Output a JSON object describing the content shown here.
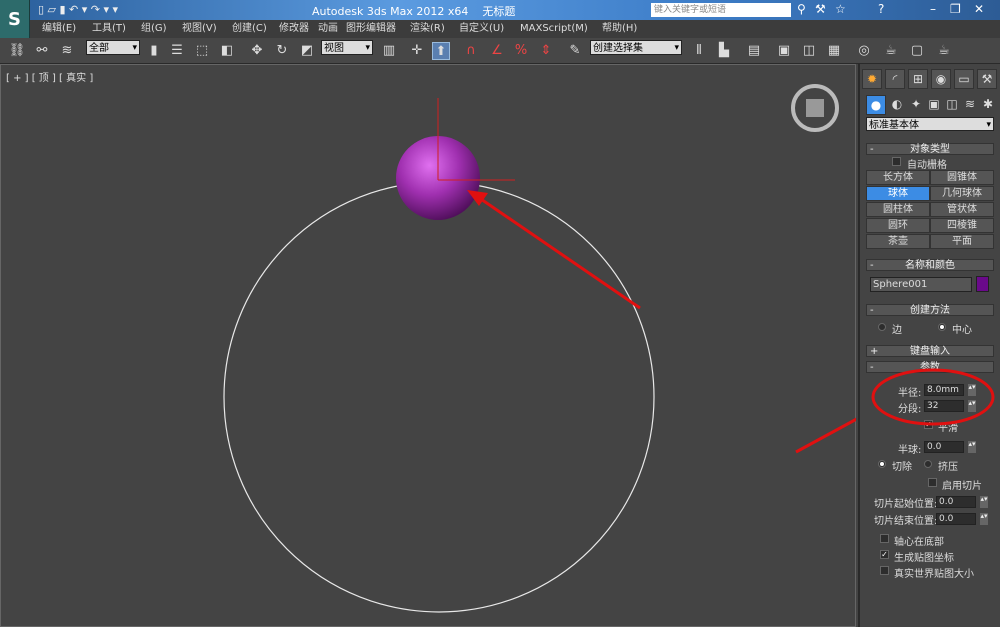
{
  "title_bar": {
    "app_title": "Autodesk 3ds Max  2012 x64",
    "doc_title": "无标题",
    "search_placeholder": "键入关键字或短语"
  },
  "menu": [
    "编辑(E)",
    "工具(T)",
    "组(G)",
    "视图(V)",
    "创建(C)",
    "修改器",
    "动画",
    "图形编辑器",
    "渲染(R)",
    "自定义(U)",
    "MAXScript(M)",
    "帮助(H)"
  ],
  "toolbar": {
    "selection_filter": "全部",
    "reference_coord": "视图",
    "named_selection": "创建选择集"
  },
  "viewport": {
    "label": "[ + ] [ 顶 ] [ 真实 ]",
    "sphere_color": "#a030b0",
    "annotation_color": "#e01010"
  },
  "panel": {
    "category_dropdown": "标准基本体",
    "object_type": {
      "header": "对象类型",
      "autogrid": "自动栅格",
      "buttons": [
        "长方体",
        "圆锥体",
        "球体",
        "几何球体",
        "圆柱体",
        "管状体",
        "圆环",
        "四棱锥",
        "茶壶",
        "平面"
      ],
      "selected": "球体"
    },
    "name_color": {
      "header": "名称和颜色",
      "name": "Sphere001",
      "color": "#6a0a8a"
    },
    "creation_method": {
      "header": "创建方法",
      "options": [
        "边",
        "中心"
      ],
      "selected": "中心"
    },
    "keyboard_entry": {
      "header": "键盘输入"
    },
    "parameters": {
      "header": "参数",
      "radius_label": "半径:",
      "radius": "8.0mm",
      "segments_label": "分段:",
      "segments": "32",
      "smooth": "平滑",
      "hemisphere_label": "半球:",
      "hemisphere": "0.0",
      "chop": "切除",
      "squash": "挤压",
      "slice_on": "启用切片",
      "slice_from_label": "切片起始位置:",
      "slice_from": "0.0",
      "slice_to_label": "切片结束位置:",
      "slice_to": "0.0",
      "base_to_pivot": "轴心在底部",
      "gen_map_coords": "生成贴图坐标",
      "real_world_map": "真实世界贴图大小"
    }
  }
}
